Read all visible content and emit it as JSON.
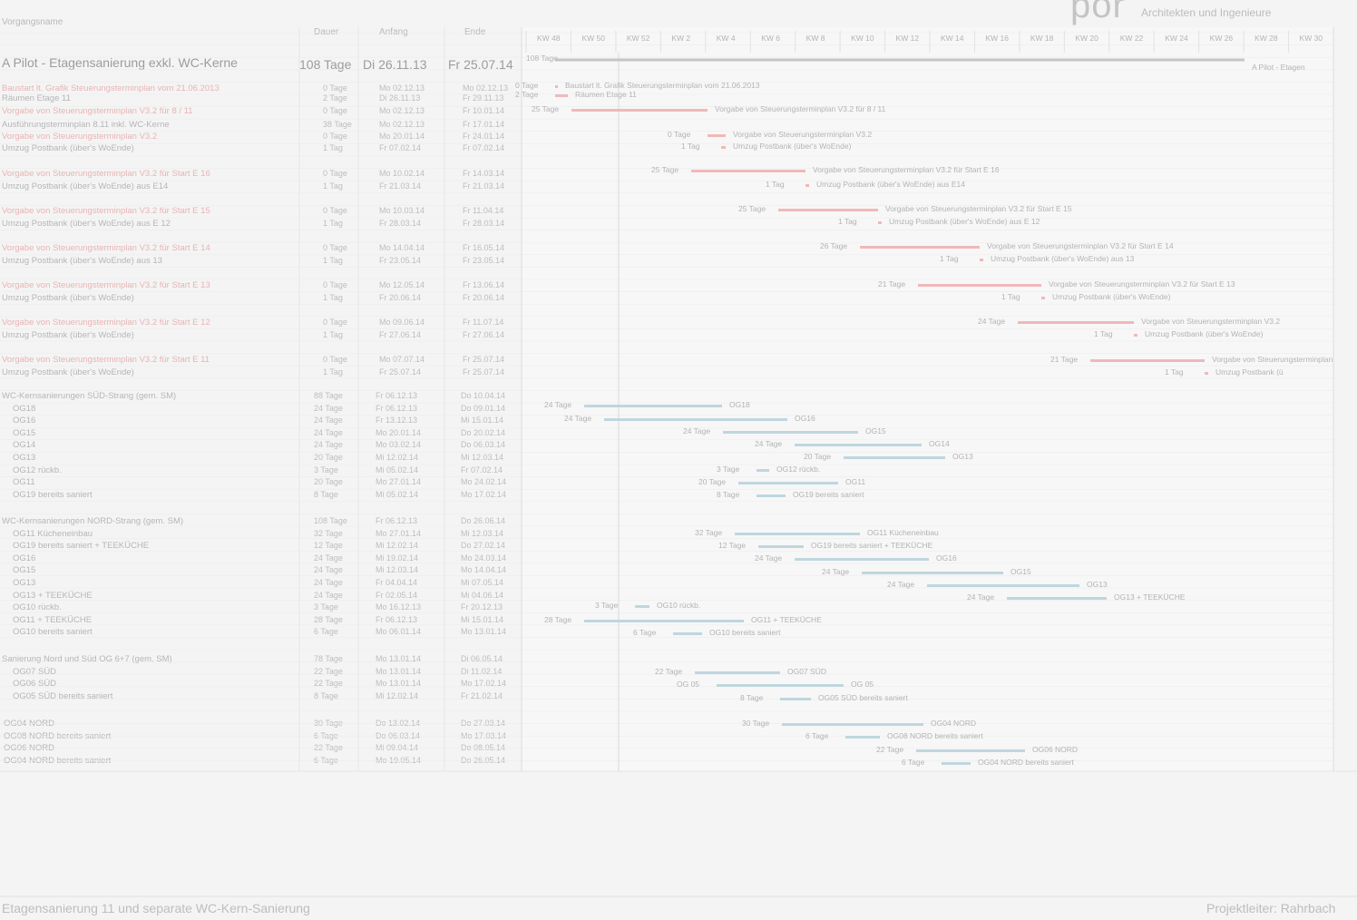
{
  "brand": {
    "logo": "por",
    "tagline": "Architekten und Ingenieure"
  },
  "table": {
    "headers": {
      "name": "Vorgangsname",
      "duration": "Dauer",
      "start": "Anfang",
      "end": "Ende"
    },
    "project": {
      "name": "A Pilot - Etagensanierung exkl. WC-Kerne",
      "duration": "108 Tage",
      "start": "Di 26.11.13",
      "end": "Fr 25.07.14"
    }
  },
  "rows": [
    {
      "name": "Baustart lt. Grafik Steuerungsterminplan vom 21.06.2013",
      "dur": "0 Tage",
      "start": "Mo 02.12.13",
      "end": "Mo 02.12.13",
      "red": true
    },
    {
      "name": "Räumen Etage 11",
      "dur": "2 Tage",
      "start": "Di 26.11.13",
      "end": "Fr 29.11.13",
      "red": false
    },
    {
      "name": "Vorgabe von Steuerungsterminplan V3.2 für 8 / 11",
      "dur": "0 Tage",
      "start": "Mo 02.12.13",
      "end": "Fr 10.01.14",
      "red": true
    },
    {
      "name": "Ausführungsterminplan 8.11 inkl. WC-Kerne",
      "dur": "38 Tage",
      "start": "Mo 02.12.13",
      "end": "Fr 17.01.14",
      "red": false
    },
    {
      "name": "Vorgabe von Steuerungsterminplan V3.2",
      "dur": "0 Tage",
      "start": "Mo 20.01.14",
      "end": "Fr 24.01.14",
      "red": true
    },
    {
      "name": "Umzug Postbank (über's WoEnde)",
      "dur": "1 Tag",
      "start": "Fr 07.02.14",
      "end": "Fr 07.02.14",
      "red": false
    },
    {
      "name": "Vorgabe von Steuerungsterminplan V3.2 für Start E 16",
      "dur": "0 Tage",
      "start": "Mo 10.02.14",
      "end": "Fr 14.03.14",
      "red": true
    },
    {
      "name": "Umzug Postbank (über's WoEnde) aus E14",
      "dur": "1 Tag",
      "start": "Fr 21.03.14",
      "end": "Fr 21.03.14",
      "red": false
    },
    {
      "name": "Vorgabe von Steuerungsterminplan V3.2 für Start E 15",
      "dur": "0 Tage",
      "start": "Mo 10.03.14",
      "end": "Fr 11.04.14",
      "red": true
    },
    {
      "name": "Umzug Postbank (über's WoEnde) aus E 12",
      "dur": "1 Tag",
      "start": "Fr 28.03.14",
      "end": "Fr 28.03.14",
      "red": false
    },
    {
      "name": "Vorgabe von Steuerungsterminplan V3.2 für Start E 14",
      "dur": "0 Tage",
      "start": "Mo 14.04.14",
      "end": "Fr 16.05.14",
      "red": true
    },
    {
      "name": "Umzug Postbank (über's WoEnde) aus 13",
      "dur": "1 Tag",
      "start": "Fr 23.05.14",
      "end": "Fr 23.05.14",
      "red": false
    },
    {
      "name": "Vorgabe von Steuerungsterminplan V3.2 für Start E 13",
      "dur": "0 Tage",
      "start": "Mo 12.05.14",
      "end": "Fr 13.06.14",
      "red": true
    },
    {
      "name": "Umzug Postbank (über's WoEnde)",
      "dur": "1 Tag",
      "start": "Fr 20.06.14",
      "end": "Fr 20.06.14",
      "red": false
    },
    {
      "name": "Vorgabe von Steuerungsterminplan V3.2 für Start E 12",
      "dur": "0 Tage",
      "start": "Mo 09.06.14",
      "end": "Fr 11.07.14",
      "red": true
    },
    {
      "name": "Umzug Postbank (über's WoEnde)",
      "dur": "1 Tag",
      "start": "Fr 27.06.14",
      "end": "Fr 27.06.14",
      "red": false
    },
    {
      "name": "Vorgabe von Steuerungsterminplan V3.2 für Start E 11",
      "dur": "0 Tage",
      "start": "Mo 07.07.14",
      "end": "Fr 25.07.14",
      "red": true
    },
    {
      "name": "Umzug Postbank (über's WoEnde)",
      "dur": "1 Tag",
      "start": "Fr 25.07.14",
      "end": "Fr 25.07.14",
      "red": false
    }
  ],
  "groups": [
    {
      "name": "WC-Kernsanierungen SÜD-Strang (gem. SM)",
      "dur": "88 Tage",
      "start": "Fr 06.12.13",
      "end": "Do 10.04.14",
      "items": [
        {
          "name": "OG18",
          "dur": "24 Tage",
          "start": "Fr 06.12.13",
          "end": "Do 09.01.14"
        },
        {
          "name": "OG16",
          "dur": "24 Tage",
          "start": "Fr 13.12.13",
          "end": "Mi 15.01.14"
        },
        {
          "name": "OG15",
          "dur": "24 Tage",
          "start": "Mo 20.01.14",
          "end": "Do 20.02.14"
        },
        {
          "name": "OG14",
          "dur": "24 Tage",
          "start": "Mo 03.02.14",
          "end": "Do 06.03.14"
        },
        {
          "name": "OG13",
          "dur": "20 Tage",
          "start": "Mi 12.02.14",
          "end": "Mi 12.03.14"
        },
        {
          "name": "OG12 rückb.",
          "dur": "3 Tage",
          "start": "Mi 05.02.14",
          "end": "Fr 07.02.14"
        },
        {
          "name": "OG11",
          "dur": "20 Tage",
          "start": "Mo 27.01.14",
          "end": "Mo 24.02.14"
        },
        {
          "name": "OG19 bereits saniert",
          "dur": "8 Tage",
          "start": "Mi 05.02.14",
          "end": "Mo 17.02.14"
        }
      ]
    },
    {
      "name": "WC-Kernsanierungen NORD-Strang (gem. SM)",
      "dur": "108 Tage",
      "start": "Fr 06.12.13",
      "end": "Do 26.06.14",
      "items": [
        {
          "name": "OG11 Kücheneinbau",
          "dur": "32 Tage",
          "start": "Mo 27.01.14",
          "end": "Mi 12.03.14"
        },
        {
          "name": "OG19 bereits saniert + TEEKÜCHE",
          "dur": "12 Tage",
          "start": "Mi 12.02.14",
          "end": "Do 27.02.14"
        },
        {
          "name": "OG16",
          "dur": "24 Tage",
          "start": "Mi 19.02.14",
          "end": "Mo 24.03.14"
        },
        {
          "name": "OG15",
          "dur": "24 Tage",
          "start": "Mi 12.03.14",
          "end": "Mo 14.04.14"
        },
        {
          "name": "OG13",
          "dur": "24 Tage",
          "start": "Fr 04.04.14",
          "end": "Mi 07.05.14"
        },
        {
          "name": "OG13 + TEEKÜCHE",
          "dur": "24 Tage",
          "start": "Fr 02.05.14",
          "end": "Mi 04.06.14"
        },
        {
          "name": "OG10 rückb.",
          "dur": "3 Tage",
          "start": "Mo 16.12.13",
          "end": "Fr 20.12.13"
        },
        {
          "name": "OG11 + TEEKÜCHE",
          "dur": "28 Tage",
          "start": "Fr 06.12.13",
          "end": "Mi 15.01.14"
        },
        {
          "name": "OG10 bereits saniert",
          "dur": "6 Tage",
          "start": "Mo 06.01.14",
          "end": "Mo 13.01.14"
        }
      ]
    },
    {
      "name": "Sanierung Nord und Süd OG 6+7 (gem. SM)",
      "dur": "78 Tage",
      "start": "Mo 13.01.14",
      "end": "Di 06.05.14",
      "items": [
        {
          "name": "OG07 SÜD",
          "dur": "22 Tage",
          "start": "Mo 13.01.14",
          "end": "Di 11.02.14"
        },
        {
          "name": "OG06 SÜD",
          "dur": "22 Tage",
          "start": "Mo 13.01.14",
          "end": "Mo 17.02.14"
        },
        {
          "name": "OG05 SÜD bereits saniert",
          "dur": "8 Tage",
          "start": "Mi 12.02.14",
          "end": "Fr 21.02.14"
        }
      ]
    },
    {
      "name": "",
      "dur": "",
      "start": "",
      "end": "",
      "items": [
        {
          "name": "OG04 NORD",
          "dur": "30 Tage",
          "start": "Do 13.02.14",
          "end": "Do 27.03.14"
        },
        {
          "name": "OG08 NORD bereits saniert",
          "dur": "6 Tage",
          "start": "Do 06.03.14",
          "end": "Mo 17.03.14"
        },
        {
          "name": "OG06 NORD",
          "dur": "22 Tage",
          "start": "Mi 09.04.14",
          "end": "Do 08.05.14"
        },
        {
          "name": "OG04 NORD bereits saniert",
          "dur": "6 Tage",
          "start": "Mo 19.05.14",
          "end": "Do 26.05.14"
        }
      ]
    }
  ],
  "gantt": {
    "timescale_top": [
      "KW 48",
      "KW 50",
      "KW 52",
      "KW 2",
      "KW 4",
      "KW 6",
      "KW 8",
      "KW 10",
      "KW 12",
      "KW 14",
      "KW 16",
      "KW 18",
      "KW 20",
      "KW 22",
      "KW 24",
      "KW 26",
      "KW 28",
      "KW 30"
    ],
    "summary_label": "108 Tage",
    "summary_label_right": "A Pilot - Etagen",
    "bars": [
      {
        "label_left": "0 Tage",
        "label_right": "Baustart lt. Grafik Steuerungsterminplan vom 21.06.2013",
        "color": "red"
      },
      {
        "label_left": "2 Tage",
        "label_right": "Räumen Etage 11",
        "color": "red"
      },
      {
        "label_left": "25 Tage",
        "label_right": "Vorgabe von Steuerungsterminplan V3.2 für 8 / 11",
        "color": "red"
      },
      {
        "label_left": "0 Tage",
        "label_right": "Vorgabe von Steuerungsterminplan V3.2",
        "color": "red"
      },
      {
        "label_left": "1 Tag",
        "label_right": "Umzug Postbank (über's WoEnde)",
        "color": "red"
      },
      {
        "label_left": "25 Tage",
        "label_right": "Vorgabe von Steuerungsterminplan V3.2 für Start E 16",
        "color": "red"
      },
      {
        "label_left": "1 Tag",
        "label_right": "Umzug Postbank (über's WoEnde) aus E14",
        "color": "red"
      },
      {
        "label_left": "25 Tage",
        "label_right": "Vorgabe von Steuerungsterminplan V3.2 für Start E 15",
        "color": "red"
      },
      {
        "label_left": "1 Tag",
        "label_right": "Umzug Postbank (über's WoEnde) aus E 12",
        "color": "red"
      },
      {
        "label_left": "26 Tage",
        "label_right": "Vorgabe von Steuerungsterminplan V3.2 für Start E 14",
        "color": "red"
      },
      {
        "label_left": "1 Tag",
        "label_right": "Umzug Postbank (über's WoEnde) aus 13",
        "color": "red"
      },
      {
        "label_left": "21 Tage",
        "label_right": "Vorgabe von Steuerungsterminplan V3.2 für Start E 13",
        "color": "red"
      },
      {
        "label_left": "1 Tag",
        "label_right": "Umzug Postbank (über's WoEnde)",
        "color": "red"
      },
      {
        "label_left": "24 Tage",
        "label_right": "Vorgabe von Steuerungsterminplan V3.2",
        "color": "red"
      },
      {
        "label_left": "1 Tag",
        "label_right": "Umzug Postbank (über's WoEnde)",
        "color": "red"
      },
      {
        "label_left": "21 Tage",
        "label_right": "Vorgabe von Steuerungsterminplan",
        "color": "red"
      },
      {
        "label_left": "1 Tag",
        "label_right": "Umzug Postbank (ü",
        "color": "red"
      },
      {
        "label_left": "24 Tage",
        "label_right": "OG18",
        "color": "blue"
      },
      {
        "label_left": "24 Tage",
        "label_right": "OG16",
        "color": "blue"
      },
      {
        "label_left": "24 Tage",
        "label_right": "OG15",
        "color": "blue"
      },
      {
        "label_left": "24 Tage",
        "label_right": "OG14",
        "color": "blue"
      },
      {
        "label_left": "20 Tage",
        "label_right": "OG13",
        "color": "blue"
      },
      {
        "label_left": "3 Tage",
        "label_right": "OG12 rückb.",
        "color": "blue"
      },
      {
        "label_left": "20 Tage",
        "label_right": "OG11",
        "color": "blue"
      },
      {
        "label_left": "8 Tage",
        "label_right": "OG19 bereits saniert",
        "color": "blue"
      },
      {
        "label_left": "32 Tage",
        "label_right": "OG11 Kücheneinbau",
        "color": "blue"
      },
      {
        "label_left": "12 Tage",
        "label_right": "OG19 bereits saniert + TEEKÜCHE",
        "color": "blue"
      },
      {
        "label_left": "24 Tage",
        "label_right": "OG16",
        "color": "blue"
      },
      {
        "label_left": "24 Tage",
        "label_right": "OG15",
        "color": "blue"
      },
      {
        "label_left": "24 Tage",
        "label_right": "OG13",
        "color": "blue"
      },
      {
        "label_left": "24 Tage",
        "label_right": "OG13 + TEEKÜCHE",
        "color": "blue"
      },
      {
        "label_left": "3 Tage",
        "label_right": "OG10 rückb.",
        "color": "blue"
      },
      {
        "label_left": "28 Tage",
        "label_right": "OG11 + TEEKÜCHE",
        "color": "blue"
      },
      {
        "label_left": "6 Tage",
        "label_right": "OG10 bereits saniert",
        "color": "blue"
      },
      {
        "label_left": "22 Tage",
        "label_right": "OG07 SÜD",
        "color": "blue"
      },
      {
        "label_left": "OG 05",
        "label_right": "OG 05",
        "color": "blue"
      },
      {
        "label_left": "8 Tage",
        "label_right": "OG05 SÜD bereits saniert",
        "color": "blue"
      },
      {
        "label_left": "30 Tage",
        "label_right": "OG04 NORD",
        "color": "blue"
      },
      {
        "label_left": "6 Tage",
        "label_right": "OG08 NORD bereits saniert",
        "color": "blue"
      },
      {
        "label_left": "22 Tage",
        "label_right": "OG06 NORD",
        "color": "blue"
      },
      {
        "label_left": "6 Tage",
        "label_right": "OG04 NORD bereits saniert",
        "color": "blue"
      }
    ]
  },
  "footer": {
    "left": "Etagensanierung 11 und separate WC-Kern-Sanierung",
    "right": "Projektleiter: Rahrbach"
  },
  "colors": {
    "red_bar": "#f0b8b8",
    "blue_bar": "#bfd6de",
    "grid": "#e6e6e6"
  }
}
